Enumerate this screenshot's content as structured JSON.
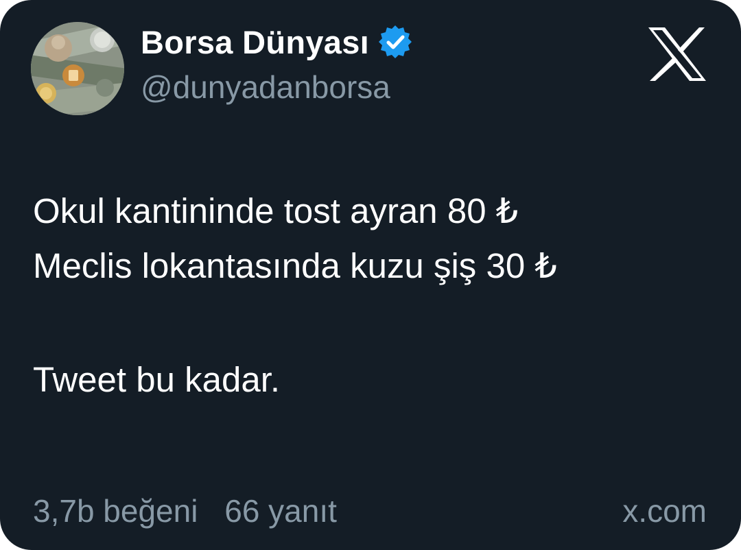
{
  "account": {
    "display_name": "Borsa Dünyası",
    "handle": "@dunyadanborsa",
    "verified": true,
    "verified_color": "#1d9bf0"
  },
  "platform": {
    "logo": "x-logo-icon"
  },
  "tweet": {
    "lines": [
      "Okul kantininde tost ayran 80 ₺",
      "Meclis lokantasında kuzu şiş 30 ₺",
      "Tweet bu kadar."
    ]
  },
  "stats": {
    "likes": "3,7b beğeni",
    "replies": "66 yanıt"
  },
  "source": "x.com",
  "colors": {
    "background": "#141d26",
    "primary_text": "#ffffff",
    "secondary_text": "#8899a6"
  }
}
